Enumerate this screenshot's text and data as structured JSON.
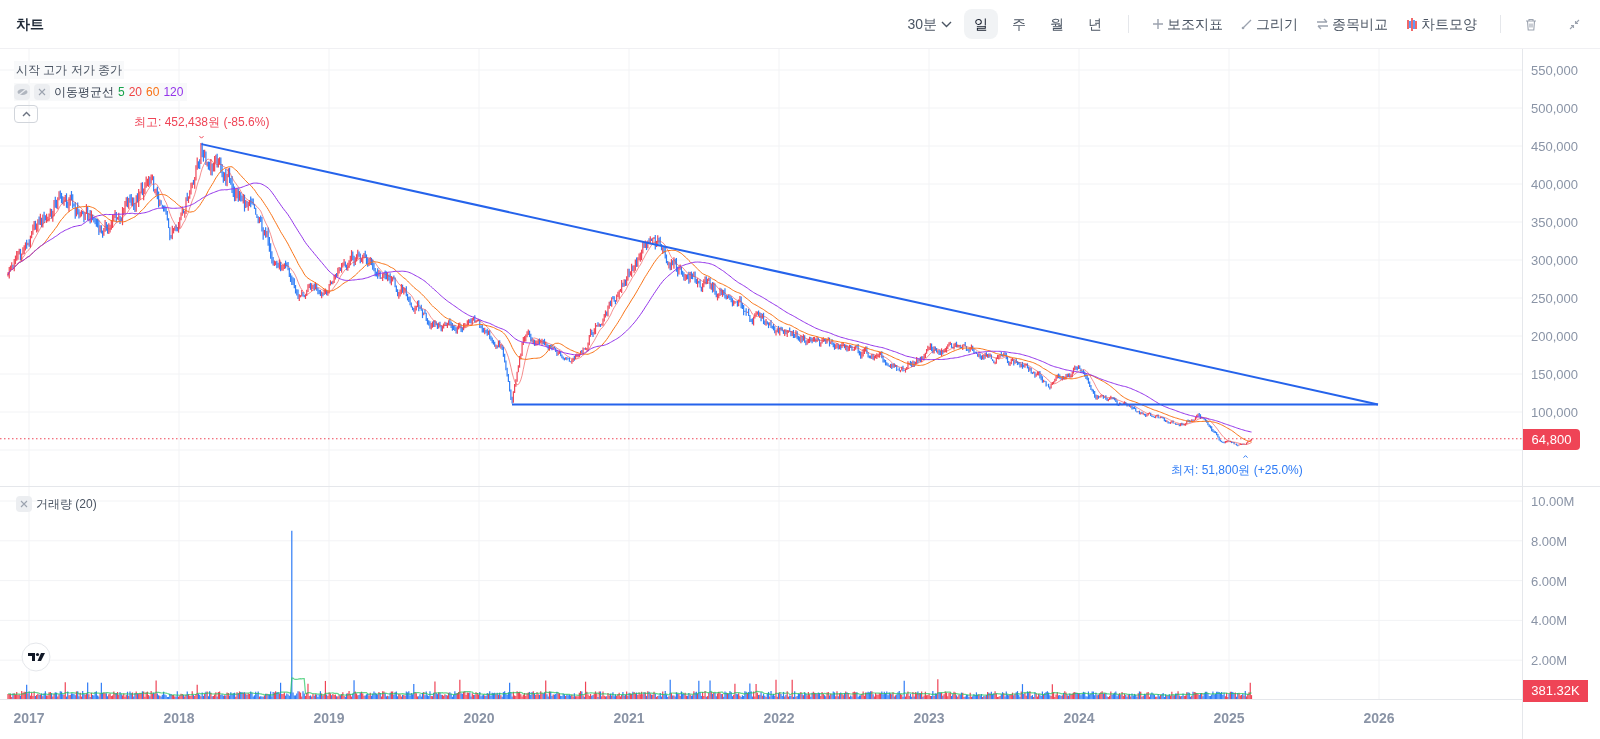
{
  "header": {
    "title": "차트",
    "interval": "30분",
    "periods": [
      {
        "label": "일",
        "selected": true
      },
      {
        "label": "주",
        "selected": false
      },
      {
        "label": "월",
        "selected": false
      },
      {
        "label": "년",
        "selected": false
      }
    ],
    "tools": [
      {
        "label": "보조지표"
      },
      {
        "label": "그리기"
      },
      {
        "label": "종목비교"
      },
      {
        "label": "차트모양"
      }
    ]
  },
  "price_pane": {
    "ohlc_legend": "시작 고가 저가 종가",
    "indicator": {
      "name": "이동평균선",
      "periods": [
        {
          "label": "5",
          "color": "#16a34a"
        },
        {
          "label": "20",
          "color": "#ef4444"
        },
        {
          "label": "60",
          "color": "#f97316"
        },
        {
          "label": "120",
          "color": "#9333ea"
        }
      ]
    },
    "high_marker": "최고: 452,438원 (-85.6%)",
    "low_marker": "최저: 51,800원 (+25.0%)",
    "y_ticks": [
      "550,000",
      "500,000",
      "450,000",
      "400,000",
      "350,000",
      "300,000",
      "250,000",
      "200,000",
      "150,000",
      "100,000"
    ],
    "last_price": "64,800"
  },
  "volume_pane": {
    "indicator": "거래량 (20)",
    "y_ticks": [
      "10.00M",
      "8.00M",
      "6.00M",
      "4.00M",
      "2.00M"
    ],
    "last_volume": "381.32K"
  },
  "x_ticks": [
    "2017",
    "2018",
    "2019",
    "2020",
    "2021",
    "2022",
    "2023",
    "2024",
    "2025",
    "2026"
  ]
}
